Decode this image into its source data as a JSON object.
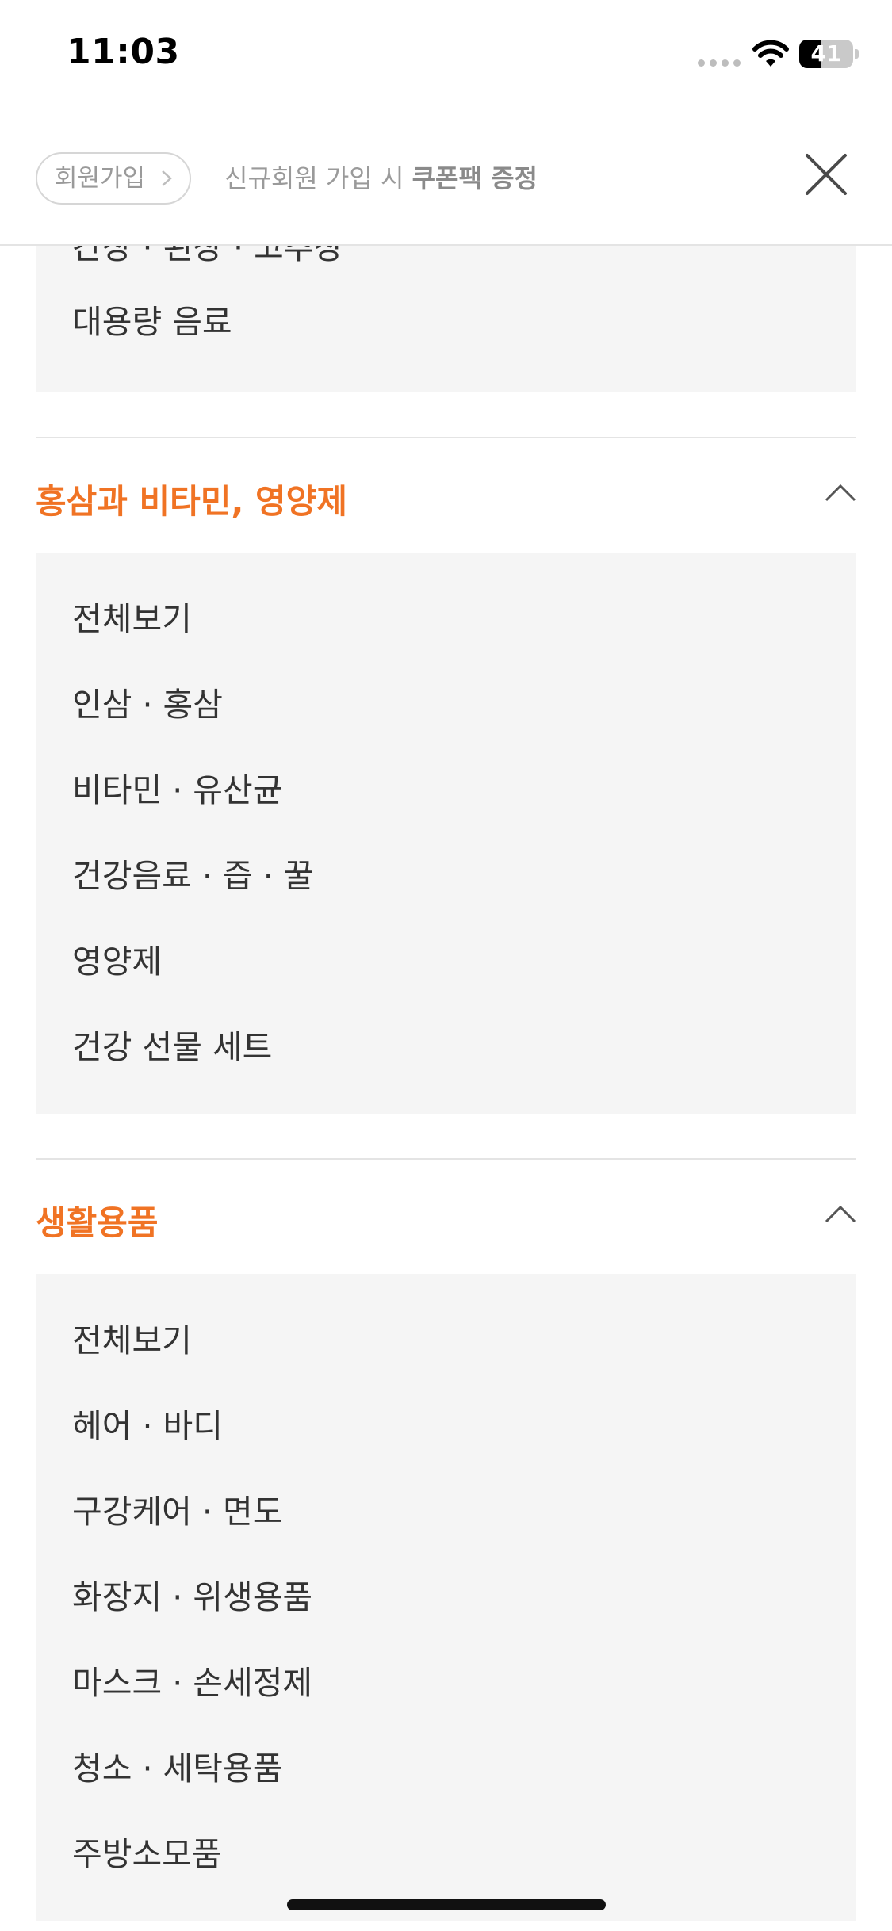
{
  "status": {
    "time": "11:03",
    "battery": "41",
    "battery_level": 0.41
  },
  "banner": {
    "signup_label": "회원가입",
    "text_prefix": "신규회원 가입 시 ",
    "text_bold": "쿠폰팩 증정"
  },
  "top_list": {
    "partial_item": "간장 · 된장 · 고추장",
    "last_item": "대용량 음료"
  },
  "sections": [
    {
      "title": "홍삼과 비타민, 영양제",
      "items": [
        "전체보기",
        "인삼 · 홍삼",
        "비타민 · 유산균",
        "건강음료 · 즙 · 꿀",
        "영양제",
        "건강 선물 세트"
      ]
    },
    {
      "title": "생활용품",
      "items": [
        "전체보기",
        "헤어 · 바디",
        "구강케어 · 면도",
        "화장지 · 위생용품",
        "마스크 · 손세정제",
        "청소 · 세탁용품",
        "주방소모품"
      ]
    }
  ],
  "colors": {
    "accent": "#f07324",
    "panel": "#f5f5f5",
    "text": "#333333"
  },
  "icons": {
    "close": "close-icon",
    "chevron": "chevron-up-icon",
    "wifi": "wifi-icon"
  }
}
